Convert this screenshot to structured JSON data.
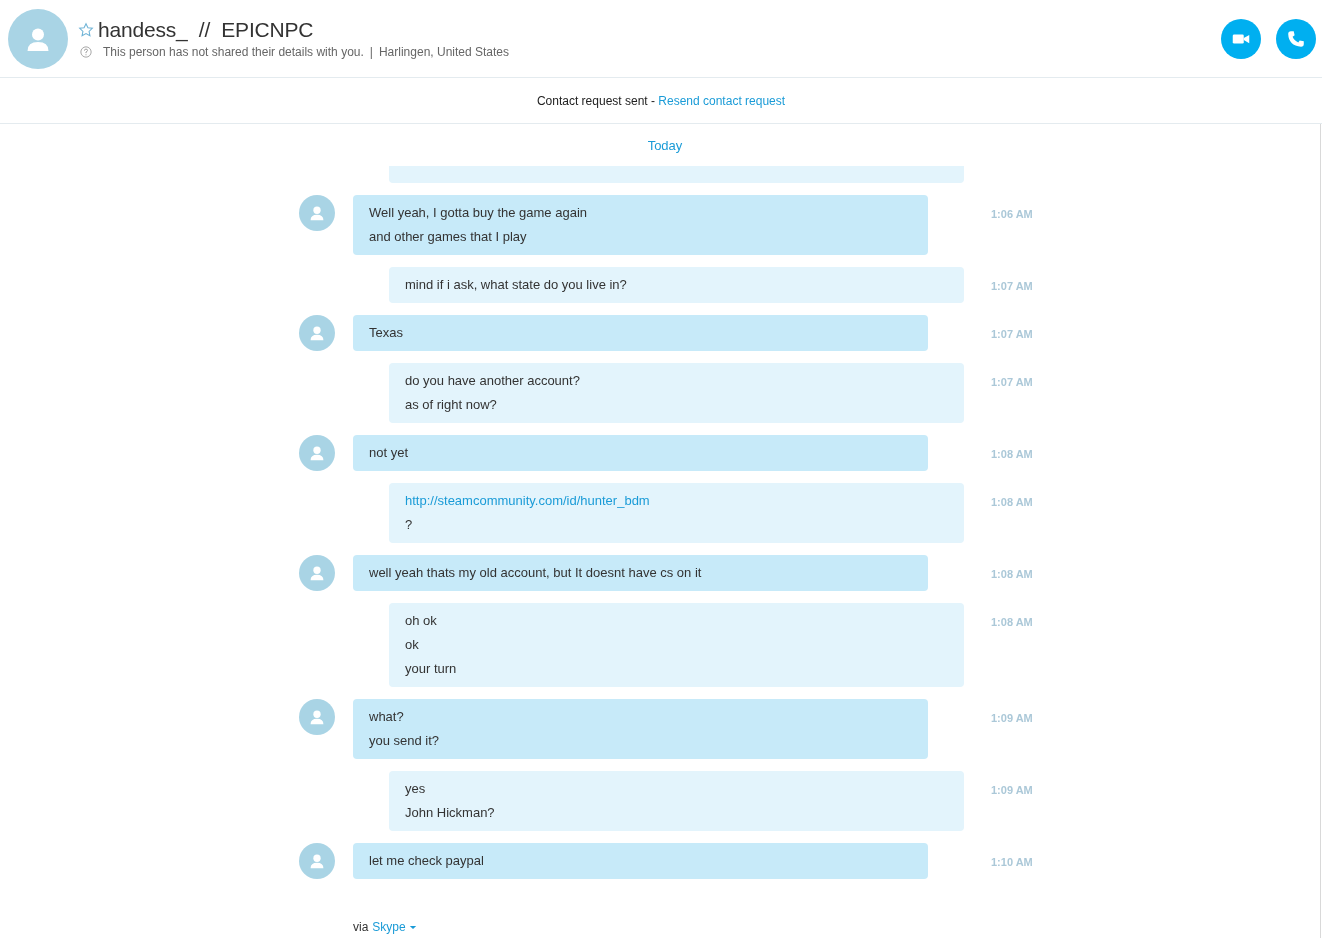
{
  "contact": {
    "name": "handess_  //  EPICNPC",
    "favorite": false,
    "details": "This person has not shared their details with you.",
    "separator": "|",
    "location": "Harlingen, United States"
  },
  "call_buttons": [
    {
      "kind": "video"
    },
    {
      "kind": "audio"
    }
  ],
  "contact_request": {
    "status": "Contact request sent - ",
    "action": "Resend contact request"
  },
  "day_label": "Today",
  "messages": [
    {
      "incoming": false,
      "kind": "partial"
    },
    {
      "incoming": true,
      "kind": "full",
      "time": "1:06 AM",
      "lines": [
        {
          "kind": "text",
          "text": "Well yeah, I gotta buy the game again"
        },
        {
          "kind": "text",
          "text": "and other games that I play"
        }
      ]
    },
    {
      "incoming": false,
      "kind": "full",
      "time": "1:07 AM",
      "lines": [
        {
          "kind": "text",
          "text": "mind if i ask, what state do you live in?"
        }
      ]
    },
    {
      "incoming": true,
      "kind": "full",
      "time": "1:07 AM",
      "lines": [
        {
          "kind": "text",
          "text": "Texas"
        }
      ]
    },
    {
      "incoming": false,
      "kind": "full",
      "time": "1:07 AM",
      "lines": [
        {
          "kind": "text",
          "text": "do you have another account?"
        },
        {
          "kind": "text",
          "text": "as of right now?"
        }
      ]
    },
    {
      "incoming": true,
      "kind": "full",
      "time": "1:08 AM",
      "lines": [
        {
          "kind": "text",
          "text": "not yet"
        }
      ]
    },
    {
      "incoming": false,
      "kind": "full",
      "time": "1:08 AM",
      "lines": [
        {
          "kind": "link",
          "text": "http://steamcommunity.com/id/hunter_bdm"
        },
        {
          "kind": "text",
          "text": "?"
        }
      ]
    },
    {
      "incoming": true,
      "kind": "full",
      "time": "1:08 AM",
      "lines": [
        {
          "kind": "text",
          "text": "well yeah thats my old account, but It doesnt have cs on it"
        }
      ]
    },
    {
      "incoming": false,
      "kind": "full",
      "time": "1:08 AM",
      "lines": [
        {
          "kind": "text",
          "text": "oh ok"
        },
        {
          "kind": "text",
          "text": "ok"
        },
        {
          "kind": "text",
          "text": "your turn"
        }
      ]
    },
    {
      "incoming": true,
      "kind": "full",
      "time": "1:09 AM",
      "lines": [
        {
          "kind": "text",
          "text": "what?"
        },
        {
          "kind": "text",
          "text": "you send it?"
        }
      ]
    },
    {
      "incoming": false,
      "kind": "full",
      "time": "1:09 AM",
      "lines": [
        {
          "kind": "text",
          "text": "yes"
        },
        {
          "kind": "text",
          "text": "John Hickman?"
        }
      ]
    },
    {
      "incoming": true,
      "kind": "full",
      "time": "1:10 AM",
      "lines": [
        {
          "kind": "text",
          "text": "let me check paypal"
        }
      ]
    }
  ],
  "footer": {
    "prefix": "via",
    "service": "Skype"
  }
}
